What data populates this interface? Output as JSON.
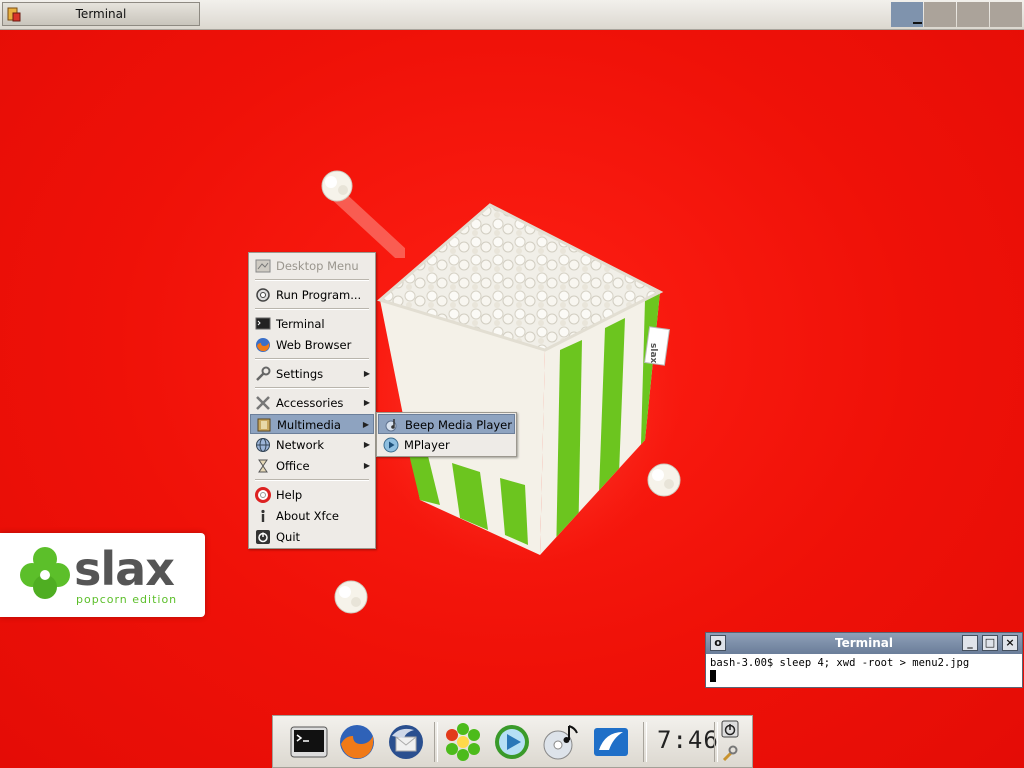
{
  "taskbar": {
    "window_title": "Terminal",
    "workspaces": [
      {
        "name": "workspace-1",
        "active": true
      },
      {
        "name": "workspace-2",
        "active": false
      },
      {
        "name": "workspace-3",
        "active": false
      },
      {
        "name": "workspace-4",
        "active": false
      }
    ]
  },
  "menu": {
    "header": "Desktop Menu",
    "run_program": "Run Program...",
    "terminal": "Terminal",
    "web_browser": "Web Browser",
    "settings": "Settings",
    "accessories": "Accessories",
    "multimedia": "Multimedia",
    "network": "Network",
    "office": "Office",
    "help": "Help",
    "about": "About Xfce",
    "quit": "Quit"
  },
  "submenu": {
    "beep_media_player": "Beep Media Player",
    "mplayer": "MPlayer"
  },
  "terminal": {
    "title": "Terminal",
    "command_line": "bash-3.00$ sleep 4; xwd -root > menu2.jpg"
  },
  "wallpaper": {
    "logo_text": "slax",
    "logo_subtitle": "popcorn edition",
    "box_label": "slax"
  },
  "dock": {
    "clock": "7:46",
    "icons": [
      "terminal-icon",
      "firefox-icon",
      "thunderbird-icon",
      "icq-icon",
      "media-player-icon",
      "audio-cd-icon",
      "mailer-icon"
    ]
  },
  "colors": {
    "wallpaper_red": "#ef1108",
    "menu_highlight": "#8ea3c0",
    "terminal_title": "#6a7d99",
    "popcorn_stripe_green": "#6cc51f"
  }
}
